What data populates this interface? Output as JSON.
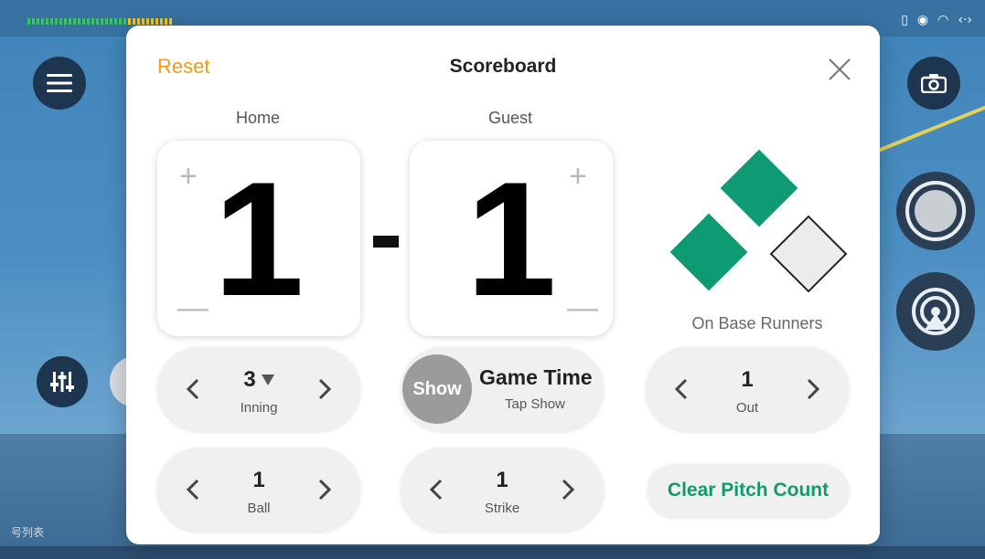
{
  "background": {
    "bottom_text": "号列表",
    "status_icons": [
      "sd-card-icon",
      "battery-icon",
      "wifi-icon",
      "code-icon"
    ]
  },
  "modal": {
    "reset_label": "Reset",
    "title": "Scoreboard",
    "home": {
      "label": "Home",
      "score": "1",
      "plus": "+",
      "minus": "—"
    },
    "guest": {
      "label": "Guest",
      "score": "1",
      "plus": "+",
      "minus": "—"
    },
    "bases": {
      "first": false,
      "second": true,
      "third": true,
      "label": "On Base Runners"
    },
    "inning": {
      "value": "3",
      "caption": "Inning"
    },
    "game_time": {
      "show_label": "Show",
      "title": "Game Time",
      "subtitle": "Tap Show"
    },
    "out": {
      "value": "1",
      "caption": "Out"
    },
    "ball": {
      "value": "1",
      "caption": "Ball"
    },
    "strike": {
      "value": "1",
      "caption": "Strike"
    },
    "clear_pitch_label": "Clear Pitch Count"
  },
  "colors": {
    "accent_orange": "#f39c12",
    "accent_green": "#0e9b73",
    "pill_bg": "#f0f0f0"
  }
}
